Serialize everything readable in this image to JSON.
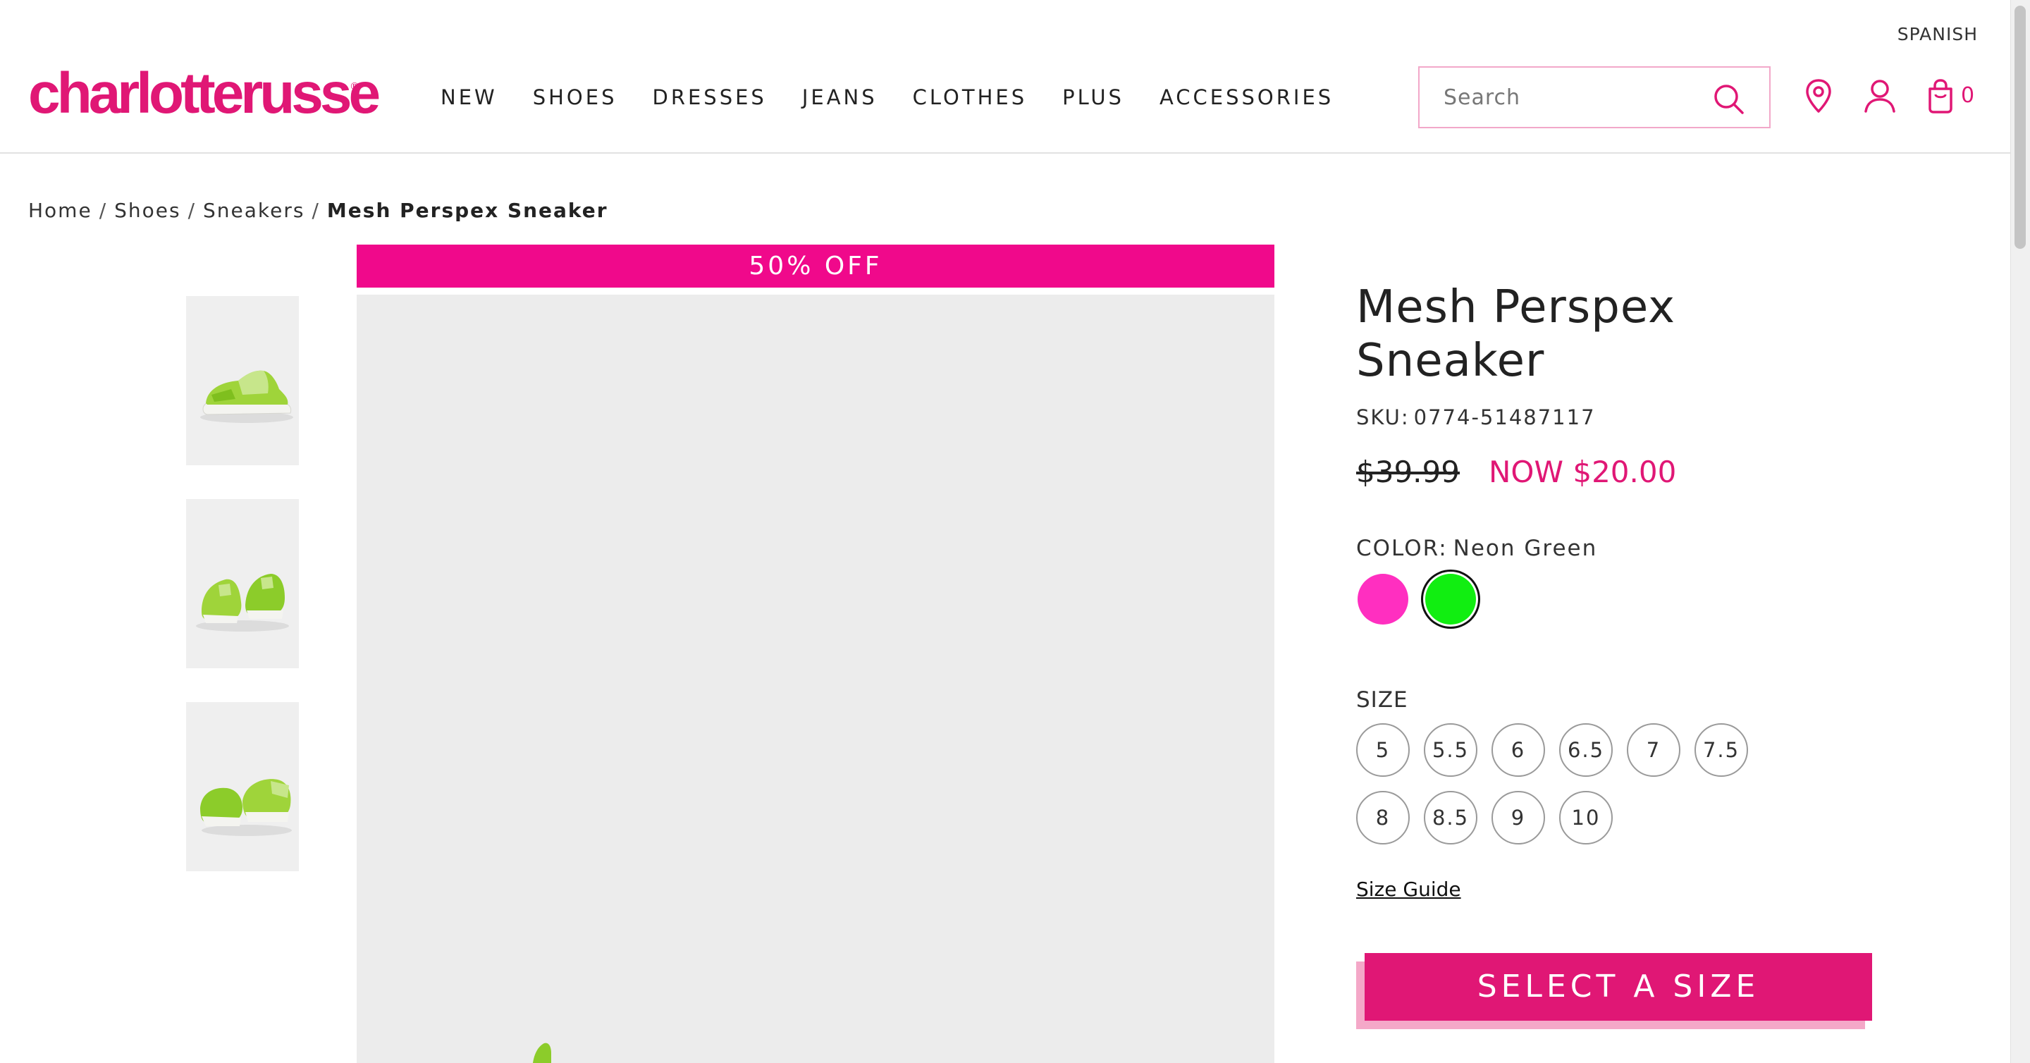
{
  "header": {
    "language_link": "SPANISH",
    "logo_text": "charlotterusse",
    "logo_mark": "®",
    "nav": [
      "NEW",
      "SHOES",
      "DRESSES",
      "JEANS",
      "CLOTHES",
      "PLUS",
      "ACCESSORIES"
    ],
    "search": {
      "placeholder": "Search",
      "icon": "search-icon"
    },
    "icons": [
      "location-pin-icon",
      "account-icon",
      "shopping-bag-icon"
    ],
    "cart_count": "0"
  },
  "breadcrumb": {
    "items": [
      "Home",
      "Shoes",
      "Sneakers"
    ],
    "separator": "/",
    "current": "Mesh Perspex Sneaker"
  },
  "gallery": {
    "sale_banner": "50% OFF",
    "thumbnails": [
      "side-view",
      "front-pair-view",
      "back-pair-view"
    ]
  },
  "product": {
    "title": "Mesh Perspex Sneaker",
    "sku_label": "SKU:",
    "sku": "0774-51487117",
    "price_original": "$39.99",
    "price_now": "NOW $20.00",
    "color_label": "COLOR:",
    "color_selected": "Neon Green",
    "swatches": [
      {
        "color": "#ff2fc0",
        "selected": false
      },
      {
        "color": "#11ee11",
        "selected": true
      }
    ],
    "size_label": "SIZE",
    "sizes": [
      "5",
      "5.5",
      "6",
      "6.5",
      "7",
      "7.5",
      "8",
      "8.5",
      "9",
      "10"
    ],
    "size_guide": "Size Guide",
    "cta": "SELECT A SIZE"
  },
  "colors": {
    "brand": "#e01775",
    "banner": "#f0098b",
    "search_border": "#f2a8c9",
    "cta_shadow": "#f4a8c8"
  }
}
